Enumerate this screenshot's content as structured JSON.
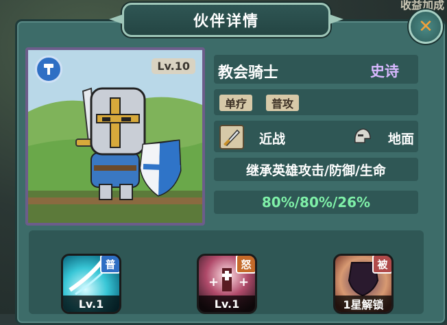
{
  "background": {
    "top_right_text": "收益加成"
  },
  "title": "伙伴详情",
  "hero": {
    "name": "教会骑士",
    "rarity": "史诗",
    "level": "Lv.10",
    "tags": [
      "单疗",
      "普攻"
    ],
    "attack_type": "近战",
    "position_type": "地面",
    "inherit_text": "继承英雄攻击/防御/生命",
    "inherit_values": "80%/80%/26%"
  },
  "skills": [
    {
      "type_label": "普",
      "level_text": "Lv.1",
      "type_color": "#2f6fc4",
      "icon": "blade-slash-icon"
    },
    {
      "type_label": "怒",
      "level_text": "Lv.1",
      "type_color": "#c46a2a",
      "icon": "holy-cross-icon"
    },
    {
      "type_label": "被",
      "level_text": "1星解锁",
      "type_color": "#b04a4a",
      "icon": "shield-locked-icon"
    }
  ],
  "colors": {
    "panel": "#3d6c69",
    "rarity": "#d8b8ff",
    "percent": "#7ff0a8",
    "portrait_border": "#6c5d8a"
  }
}
